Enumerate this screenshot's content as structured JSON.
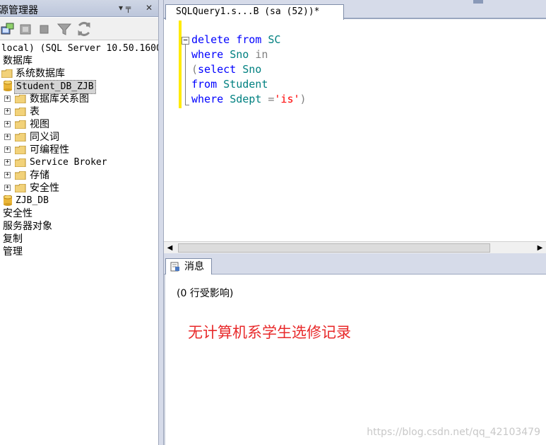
{
  "explorer": {
    "title": "源管理器",
    "pin_glyph": "▾ ╤",
    "close_glyph": "✕",
    "toolbar_icons": [
      "connect-icon",
      "disconnect-icon",
      "stop-icon",
      "filter-icon",
      "refresh-icon"
    ],
    "tree": {
      "server": "(local) (SQL Server 10.50.1600",
      "databases": "数据库",
      "system_databases": "系统数据库",
      "db_selected": "Student_DB_ZJB",
      "db_children": [
        "数据库关系图",
        "表",
        "视图",
        "同义词",
        "可编程性",
        "Service Broker",
        "存储",
        "安全性"
      ],
      "db_other": "ZJB_DB",
      "security": "安全性",
      "server_objects": "服务器对象",
      "replication": "复制",
      "management": "管理"
    }
  },
  "editor": {
    "tab_title": "SQLQuery1.s...B (sa (52))*",
    "code": {
      "line1": {
        "kw1": "delete",
        "kw2": "from",
        "id1": "SC"
      },
      "line2": {
        "kw1": "where",
        "id1": "Sno",
        "op": "in"
      },
      "line3": {
        "open": "(",
        "kw1": "select",
        "id1": "Sno"
      },
      "line4": {
        "kw1": "from",
        "id1": "Student"
      },
      "line5": {
        "kw1": "where",
        "id1": "Sdept",
        "op": "=",
        "str": "'is'",
        "close": ")"
      }
    }
  },
  "results": {
    "tab_label": "消息",
    "rows_affected": "(0 行受影响)",
    "annotation": "无计算机系学生选修记录",
    "watermark": "https://blog.csdn.net/qq_42103479"
  },
  "colors": {
    "keyword": "#0000ff",
    "identifier": "#008080",
    "string": "#ff0000",
    "annotation": "#e8292a"
  }
}
